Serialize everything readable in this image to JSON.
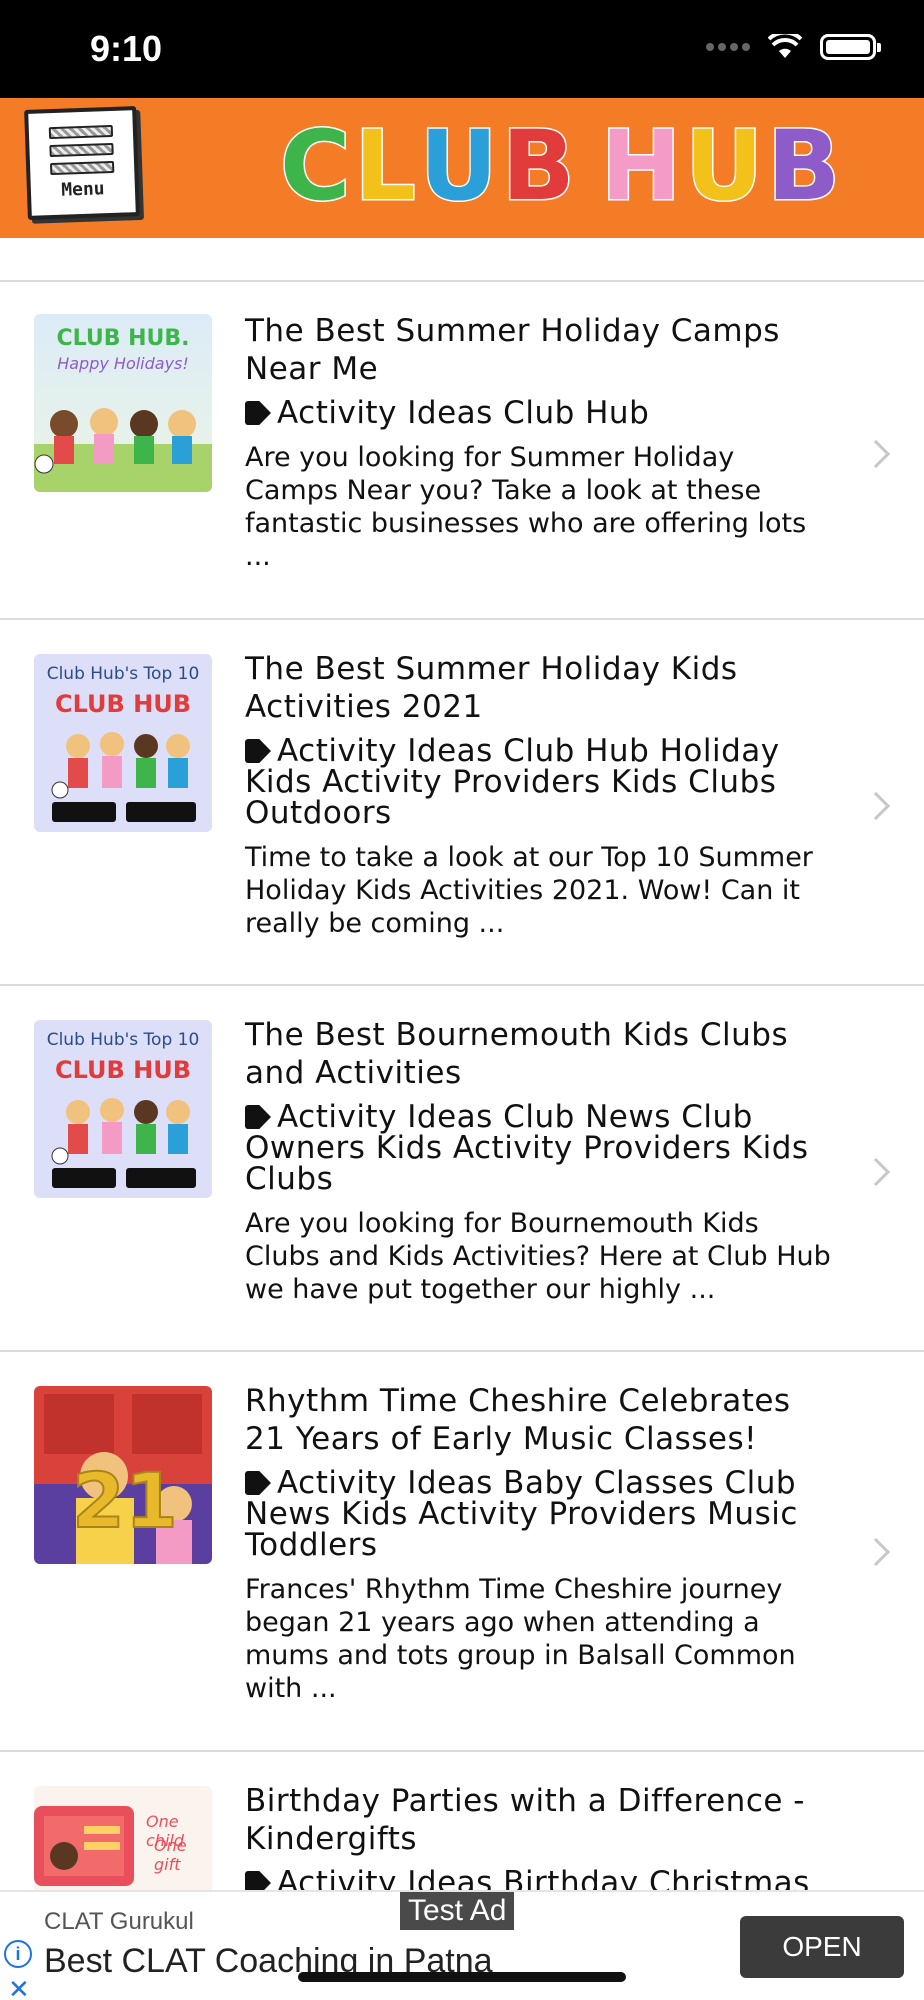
{
  "status_bar": {
    "time": "9:10"
  },
  "header": {
    "menu_label": "Menu",
    "logo_letters": [
      {
        "ch": "C",
        "color": "#3db54a"
      },
      {
        "ch": "L",
        "color": "#f2c21b"
      },
      {
        "ch": "U",
        "color": "#2a9fd8"
      },
      {
        "ch": "B",
        "color": "#e23b3b"
      },
      {
        "ch": "H",
        "color": "#f59bc8"
      },
      {
        "ch": "U",
        "color": "#f2c21b"
      },
      {
        "ch": "B",
        "color": "#8e5cc9"
      }
    ],
    "background_color": "#f47c26"
  },
  "articles": [
    {
      "title": "The Best Summer Holiday Camps Near Me",
      "tags": "Activity Ideas Club Hub",
      "excerpt": "Are you looking for Summer Holiday Camps Near you? Take a look at these fantastic businesses who are offering lots ...",
      "thumb_caption_1": "CLUB HUB.",
      "thumb_caption_2": "Happy Holidays!"
    },
    {
      "title": "The Best Summer Holiday Kids Activities 2021",
      "tags": "Activity Ideas Club Hub Holiday Kids Activity Providers Kids Clubs Outdoors",
      "excerpt": "Time to take a look at our Top 10 Summer Holiday Kids Activities 2021. Wow! Can it really be coming ...",
      "thumb_caption_1": "Club Hub's Top 10",
      "thumb_caption_2": "CLUB HUB"
    },
    {
      "title": "The Best Bournemouth Kids Clubs and Activities",
      "tags": "Activity Ideas Club News Club Owners Kids Activity Providers Kids Clubs",
      "excerpt": "Are you looking for Bournemouth Kids Clubs and Kids Activities? Here at Club Hub we have put together our highly ...",
      "thumb_caption_1": "Club Hub's Top 10",
      "thumb_caption_2": "CLUB HUB"
    },
    {
      "title": "Rhythm Time Cheshire Celebrates 21 Years of Early Music Classes!",
      "tags": "Activity Ideas Baby Classes Club News Kids Activity Providers Music Toddlers",
      "excerpt": "Frances' Rhythm Time Cheshire journey began 21 years ago when attending a mums and tots group in Balsall Common with ...",
      "thumb_caption_1": "21",
      "thumb_caption_2": ""
    },
    {
      "title": "Birthday Parties with a Difference - Kindergifts",
      "tags": "Activity Ideas Birthday Christmas",
      "excerpt": "",
      "thumb_caption_1": "One child",
      "thumb_caption_2": "One gift"
    }
  ],
  "ad": {
    "label": "Test Ad",
    "advertiser": "CLAT Gurukul",
    "headline": "Best CLAT Coaching in Patna",
    "cta": "OPEN",
    "info_glyph": "i",
    "close_glyph": "✕"
  }
}
